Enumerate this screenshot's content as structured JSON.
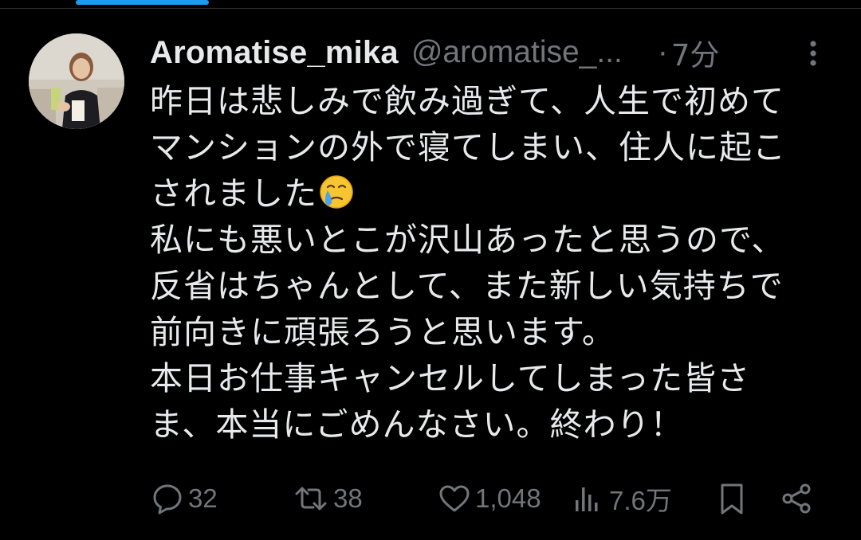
{
  "tweet": {
    "display_name": "Aromatise_mika",
    "handle": "@aromatise_...",
    "separator": "·",
    "time": "7分",
    "lines": [
      "昨日は悲しみで飲み過ぎて、人生で初めて",
      "マンションの外で寝てしまい、住人に起こ",
      "されました",
      "私にも悪いとこが沢山あったと思うので、",
      "反省はちゃんとして、また新しい気持ちで",
      "前向きに頑張ろうと思います。",
      "本日お仕事キャンセルしてしまった皆さ",
      "ま、本当にごめんなさい。終わり！"
    ],
    "emoji": "face-holding-back-tears"
  },
  "actions": {
    "replies": "32",
    "reposts": "38",
    "likes": "1,048",
    "views": "7.6万"
  },
  "colors": {
    "background": "#000000",
    "text_primary": "#e7e9ea",
    "text_secondary": "#71767b",
    "accent": "#1d9bf0",
    "divider": "#2f3336"
  },
  "icons": {
    "more": "more-vertical-icon",
    "reply": "reply-bubble-icon",
    "repost": "repost-icon",
    "like": "heart-icon",
    "views": "views-bar-chart-icon",
    "bookmark": "bookmark-icon",
    "share": "share-icon"
  }
}
